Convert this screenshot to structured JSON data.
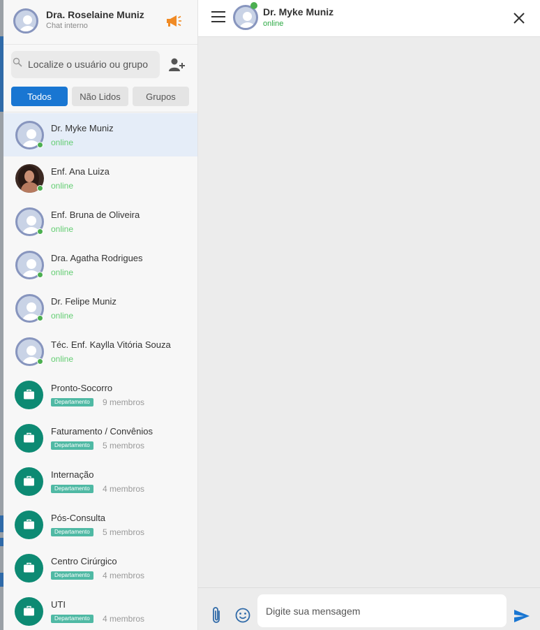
{
  "sidebar": {
    "me": {
      "name": "Dra. Roselaine Muniz",
      "subtitle": "Chat interno"
    },
    "search": {
      "placeholder": "Localize o usuário ou grupo"
    },
    "tabs": [
      {
        "label": "Todos",
        "active": true
      },
      {
        "label": "Não Lidos",
        "active": false
      },
      {
        "label": "Grupos",
        "active": false
      }
    ],
    "contacts": [
      {
        "name": "Dr. Myke Muniz",
        "status": "online",
        "avatar": "default-avatar-icon",
        "selected": true
      },
      {
        "name": "Enf. Ana Luiza",
        "status": "online",
        "avatar": "photo"
      },
      {
        "name": "Enf. Bruna de Oliveira",
        "status": "online",
        "avatar": "default-avatar-icon"
      },
      {
        "name": "Dra. Agatha Rodrigues",
        "status": "online",
        "avatar": "default-avatar-icon"
      },
      {
        "name": "Dr. Felipe Muniz",
        "status": "online",
        "avatar": "default-avatar-icon"
      },
      {
        "name": "Téc. Enf. Kaylla Vitória Souza",
        "status": "online",
        "avatar": "default-avatar-icon"
      }
    ],
    "groups": [
      {
        "name": "Pronto-Socorro",
        "badge": "Departamento",
        "members": "9 membros"
      },
      {
        "name": "Faturamento / Convênios",
        "badge": "Departamento",
        "members": "5 membros"
      },
      {
        "name": "Internação",
        "badge": "Departamento",
        "members": "4 membros"
      },
      {
        "name": "Pós-Consulta",
        "badge": "Departamento",
        "members": "5 membros"
      },
      {
        "name": "Centro Cirúrgico",
        "badge": "Departamento",
        "members": "4 membros"
      },
      {
        "name": "UTI",
        "badge": "Departamento",
        "members": "4 membros"
      }
    ]
  },
  "chat": {
    "contact_name": "Dr. Myke Muniz",
    "contact_status": "online",
    "composer_placeholder": "Digite sua mensagem"
  },
  "colors": {
    "accent": "#1976d2",
    "online": "#4caf50",
    "group": "#0d8a73",
    "megaphone": "#f08a24"
  }
}
